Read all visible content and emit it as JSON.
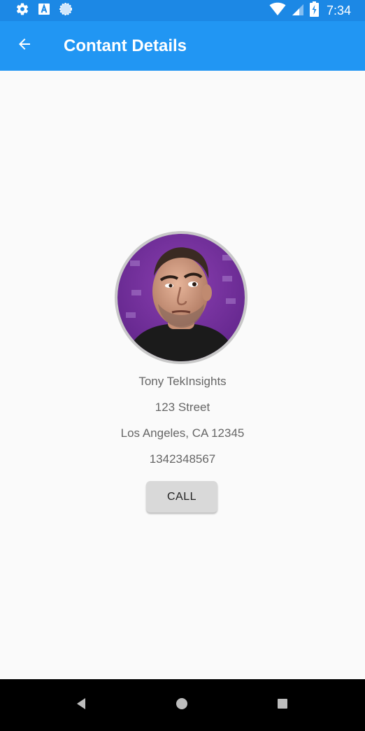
{
  "status_bar": {
    "time": "7:34",
    "left_icons": [
      "settings-icon",
      "font-a-icon",
      "circle-sync-icon"
    ],
    "right_icons": [
      "wifi-icon",
      "cell-signal-icon",
      "battery-icon"
    ]
  },
  "app_bar": {
    "title": "Contant Details",
    "back_icon": "arrow-back-icon",
    "color": "#2196f3"
  },
  "contact": {
    "name": "Tony TekInsights",
    "street": "123 Street",
    "city_line": "Los Angeles, CA 12345",
    "phone": "1342348567",
    "call_label": "CALL"
  },
  "nav_bar": {
    "icons": [
      "back-triangle-icon",
      "home-circle-icon",
      "recents-square-icon"
    ]
  }
}
